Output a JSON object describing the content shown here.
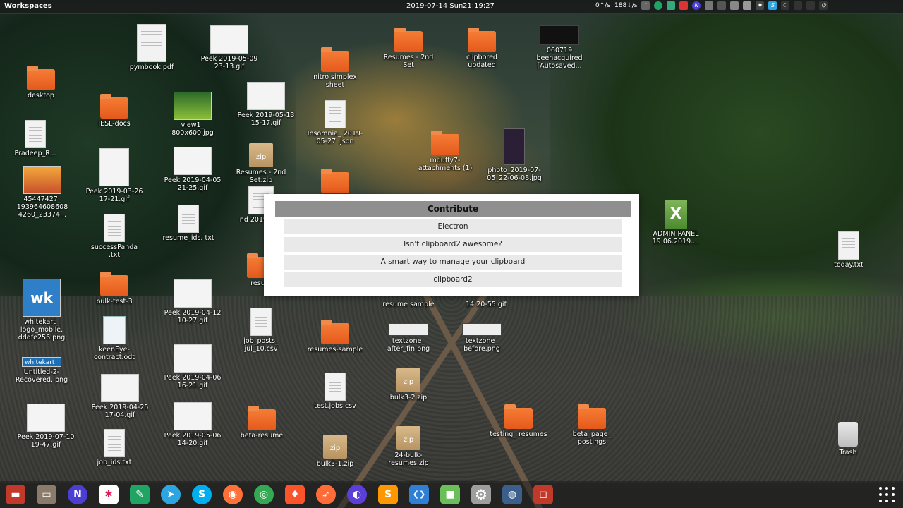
{
  "topbar": {
    "workspaces": "Workspaces",
    "date": "2019-07-14 Sun",
    "time": "21:19:27",
    "net_up": "0↑/s",
    "net_down": "188↓/s"
  },
  "desktop_icons": [
    {
      "name": "pymbook.pdf",
      "type": "doc"
    },
    {
      "name": "Peek 2019-05-09 23-13.gif",
      "type": "thumb"
    },
    {
      "name": "desktop",
      "type": "folder"
    },
    {
      "name": "IESL-docs",
      "type": "folder"
    },
    {
      "name": "view1_ 800x600.jpg",
      "type": "thumb-green"
    },
    {
      "name": "Peek 2019-05-13 15-17.gif",
      "type": "thumb"
    },
    {
      "name": "Pradeep_R...",
      "type": "doc"
    },
    {
      "name": "45447427_ 193964608608 4260_23374...",
      "type": "thumb"
    },
    {
      "name": "Peek 2019-03-26 17-21.gif",
      "type": "thumb"
    },
    {
      "name": "Peek 2019-04-05 21-25.gif",
      "type": "thumb"
    },
    {
      "name": "Resumes - 2nd Set.zip",
      "type": "zip"
    },
    {
      "name": "successPanda .txt",
      "type": "doc"
    },
    {
      "name": "resume_ids. txt",
      "type": "doc"
    },
    {
      "name": "nd 201905...",
      "type": "doc"
    },
    {
      "name": "whitekart_ logo_mobile. dddfe256.png",
      "type": "wk"
    },
    {
      "name": "bulk-test-3",
      "type": "folder"
    },
    {
      "name": "Peek 2019-04-12 10-27.gif",
      "type": "thumb"
    },
    {
      "name": "resu...",
      "type": "folder"
    },
    {
      "name": "job_posts_ jul_10.csv",
      "type": "doc"
    },
    {
      "name": "keenEye-contract.odt",
      "type": "odt"
    },
    {
      "name": "Untitled-2-Recovered. png",
      "type": "wkbar"
    },
    {
      "name": "Peek 2019-04-06 16-21.gif",
      "type": "thumb"
    },
    {
      "name": "Peek 2019-04-25 17-04.gif",
      "type": "thumb"
    },
    {
      "name": "Peek 2019-07-10 19-47.gif",
      "type": "thumb"
    },
    {
      "name": "Peek 2019-05-06 14-20.gif",
      "type": "thumb"
    },
    {
      "name": "job_ids.txt",
      "type": "doc"
    },
    {
      "name": "beta-resume",
      "type": "folder"
    },
    {
      "name": "nitro simplex sheet",
      "type": "folder"
    },
    {
      "name": "Insomnia_ 2019-05-27 .json",
      "type": "doc"
    },
    {
      "name": "Resumes - 2nd Set",
      "type": "folder"
    },
    {
      "name": "clipbored updated",
      "type": "folder"
    },
    {
      "name": "060719 beenacquired [Autosaved...",
      "type": "thumb-dark"
    },
    {
      "name": "mduffy7-attachments (1)",
      "type": "folder"
    },
    {
      "name": "photo_2019-07-05_22-06-08.jpg",
      "type": "phone"
    },
    {
      "name": "resume sample",
      "type": "label-only"
    },
    {
      "name": "14 20-55.gif",
      "type": "label-only"
    },
    {
      "name": "resumes-sample",
      "type": "folder"
    },
    {
      "name": "textzone_ after_fin.png",
      "type": "thumb-dark"
    },
    {
      "name": "textzone_ before.png",
      "type": "thumb-dark"
    },
    {
      "name": "test.jobs.csv",
      "type": "doc"
    },
    {
      "name": "bulk3-2.zip",
      "type": "zip"
    },
    {
      "name": "bulk3-1.zip",
      "type": "zip"
    },
    {
      "name": "24-bulk-resumes.zip",
      "type": "zip"
    },
    {
      "name": "testing_ resumes",
      "type": "folder"
    },
    {
      "name": "beta_page_ postings",
      "type": "folder"
    },
    {
      "name": "ADMIN PANEL 19.06.2019....",
      "type": "xlsx"
    },
    {
      "name": "today.txt",
      "type": "doc"
    },
    {
      "name": "Trash",
      "type": "trash"
    }
  ],
  "popup": {
    "title": "Contribute",
    "items": [
      "Electron",
      "Isn't clipboard2 awesome?",
      "A smart way to manage your clipboard",
      "clipboard2"
    ]
  },
  "dock": {
    "apps": [
      {
        "icon": "terminal-red-icon",
        "glyph": "▬",
        "color": "#c0392b"
      },
      {
        "icon": "files-icon",
        "glyph": "▭",
        "color": "#8a7b6b"
      },
      {
        "icon": "n-app-icon",
        "glyph": "N",
        "color": "#4a3fd1"
      },
      {
        "icon": "slack-icon",
        "glyph": "✱",
        "color": "#ffffff"
      },
      {
        "icon": "chat-green-icon",
        "glyph": "✎",
        "color": "#1fa463"
      },
      {
        "icon": "telegram-icon",
        "glyph": "➤",
        "color": "#2ca5e0"
      },
      {
        "icon": "skype-icon",
        "glyph": "S",
        "color": "#00aff0"
      },
      {
        "icon": "firefox-icon",
        "glyph": "◉",
        "color": "#ff7139"
      },
      {
        "icon": "chrome-icon",
        "glyph": "◎",
        "color": "#34a853"
      },
      {
        "icon": "brave-icon",
        "glyph": "♦",
        "color": "#fb542b"
      },
      {
        "icon": "postman-icon",
        "glyph": "➶",
        "color": "#ff6c37"
      },
      {
        "icon": "browser-purple-icon",
        "glyph": "◐",
        "color": "#5b3fd6"
      },
      {
        "icon": "sublime-icon",
        "glyph": "S",
        "color": "#ff9800"
      },
      {
        "icon": "vscode-icon",
        "glyph": "❮❯",
        "color": "#2f7fd5"
      },
      {
        "icon": "3d-box-icon",
        "glyph": "■",
        "color": "#6bbf59"
      },
      {
        "icon": "settings-gear-icon",
        "glyph": "⚙",
        "color": "#9e9e9e"
      },
      {
        "icon": "mysql-workbench-icon",
        "glyph": "◍",
        "color": "#3b5f8a"
      },
      {
        "icon": "screen-recorder-icon",
        "glyph": "◻",
        "color": "#c0392b"
      }
    ]
  }
}
